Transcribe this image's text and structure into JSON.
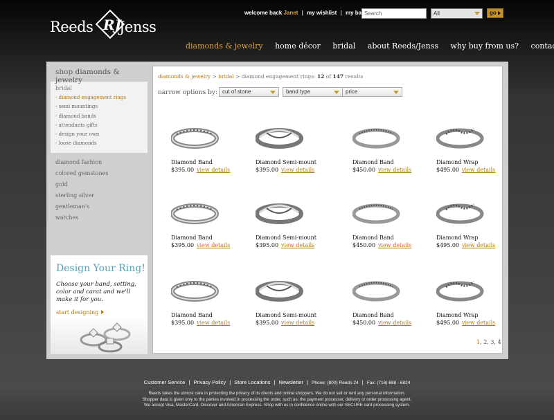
{
  "brand": {
    "left": "Reeds",
    "right": "Jenss",
    "monogram": "RJ"
  },
  "utility": {
    "welcome": "welcome back",
    "user": "Janet",
    "wishlist": "my wishlist",
    "bag": "my bag",
    "sep": "|"
  },
  "search": {
    "placeholder": "Search",
    "scope": "All",
    "go": "go"
  },
  "nav": [
    {
      "label": "diamonds & jewelry",
      "active": true
    },
    {
      "label": "home décor"
    },
    {
      "label": "bridal"
    },
    {
      "label": "about Reeds/Jenss"
    },
    {
      "label": "why buy from us?"
    },
    {
      "label": "contact"
    }
  ],
  "sidebar": {
    "title_prefix": "shop",
    "title": "diamonds & jewelry",
    "section": "bridal",
    "bridal_items": [
      "- diamond engagement rings",
      "- semi mountings",
      "- diamond bands",
      "- attendants gifts",
      "- design your own",
      "- loose diamonds"
    ],
    "categories": [
      "diamond fashion",
      "colored gemstones",
      "gold",
      "sterling silver",
      "gentleman's",
      "watches"
    ]
  },
  "promo": {
    "title": "Design Your Ring!",
    "body": "Choose your band, setting, color and carat and we'll make it for you.",
    "cta": "start designing"
  },
  "breadcrumb": {
    "c1": "diamonds & jewelry",
    "sep": ">",
    "c2": "bridal",
    "current": "diamond engagement rings:",
    "shown": "12",
    "of": "of",
    "total": "147",
    "results": "results"
  },
  "filters": {
    "label": "narrow options by:",
    "cut": "cut of stone",
    "band": "band type",
    "price": "price"
  },
  "products": [
    {
      "name": "Diamond Band",
      "price": "$395.00",
      "details": "view details",
      "icon": "band-ring"
    },
    {
      "name": "Diamond Semi-mount",
      "price": "$395.00",
      "details": "view details",
      "icon": "twist-ring"
    },
    {
      "name": "Diamond Band",
      "price": "$450.00",
      "details": "view details",
      "icon": "channel-ring"
    },
    {
      "name": "Diamond Wrap",
      "price": "$495.00",
      "details": "view details",
      "icon": "wrap-ring"
    },
    {
      "name": "Diamond Band",
      "price": "$395.00",
      "details": "view details",
      "icon": "band-ring"
    },
    {
      "name": "Diamond Semi-mount",
      "price": "$395.00",
      "details": "view details",
      "icon": "twist-ring"
    },
    {
      "name": "Diamond Band",
      "price": "$450.00",
      "details": "view details",
      "icon": "channel-ring"
    },
    {
      "name": "Diamond Wrap",
      "price": "$495.00",
      "details": "view details",
      "icon": "wrap-ring"
    },
    {
      "name": "Diamond Band",
      "price": "$395.00",
      "details": "view details",
      "icon": "band-ring"
    },
    {
      "name": "Diamond Semi-mount",
      "price": "$395.00",
      "details": "view details",
      "icon": "twist-ring"
    },
    {
      "name": "Diamond Band",
      "price": "$450.00",
      "details": "view details",
      "icon": "channel-ring"
    },
    {
      "name": "Diamond Wrap",
      "price": "$495.00",
      "details": "view details",
      "icon": "wrap-ring"
    }
  ],
  "pagination": {
    "current": "1",
    "p2": "2",
    "p3": "3",
    "p4": "4",
    "sep": ","
  },
  "footer": {
    "links": [
      "Customer Service",
      "Privacy Policy",
      "Store Locations",
      "Newsletter"
    ],
    "sep": "|",
    "phone": "Phone: (800) Reeds-24",
    "fax": "Fax: (716) 688 - 6824",
    "line1": "Reeds takes the utmost care in protecting the privacy of its clients and online shoppers. We do not sell or rent any personal information.",
    "line2": "Shopper data is given only to the parties involved in processing the order, such as: the payment processor, delivery or order processing agent.",
    "line3": "We accept Visa, MasterCard, Discover and American Express.  Shop with us in confidence online with our SECURE card processing system."
  },
  "colors": {
    "accent_gold": "#b27a10",
    "promo_blue": "#5a9fb4",
    "nav_active": "#d8a44a"
  }
}
